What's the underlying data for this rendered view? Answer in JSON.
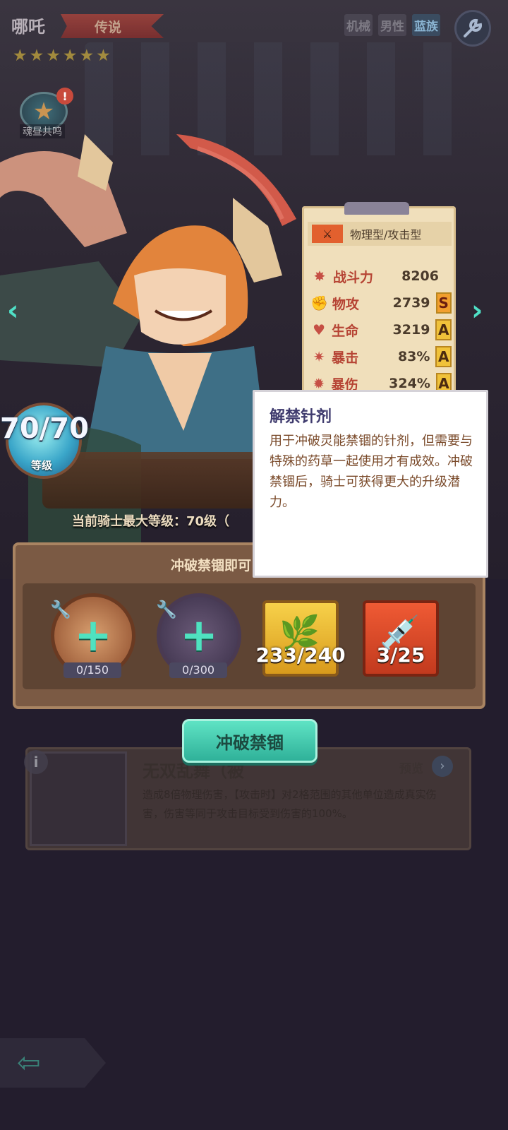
{
  "hero": {
    "name": "哪吒",
    "rarity": "传说",
    "stars": [
      "★",
      "★",
      "★",
      "★",
      "★",
      "★"
    ],
    "tags": [
      "机械",
      "男性",
      "蓝族"
    ],
    "soul_label": "魂昼共鸣"
  },
  "stats": {
    "type": "物理型/攻击型",
    "rows": [
      {
        "label": "战斗力",
        "value": "8206",
        "grade": "",
        "icon": "power-icon"
      },
      {
        "label": "物攻",
        "value": "2739",
        "grade": "S",
        "icon": "fist-icon"
      },
      {
        "label": "生命",
        "value": "3219",
        "grade": "A",
        "icon": "heart-icon"
      },
      {
        "label": "暴击",
        "value": "83%",
        "grade": "A",
        "icon": "crit-icon"
      },
      {
        "label": "暴伤",
        "value": "324%",
        "grade": "A",
        "icon": "crit-damage-icon"
      }
    ]
  },
  "level": {
    "value": "70/70",
    "label": "等级",
    "max_text": "当前骑士最大等级：70级（"
  },
  "breakthrough": {
    "title": "冲破禁锢即可",
    "slots": [
      {
        "count": "0/150",
        "icon": "hero-shard-icon"
      },
      {
        "count": "0/300",
        "icon": "hero-shard-icon"
      },
      {
        "count": "233/240",
        "icon": "herb-icon"
      },
      {
        "count": "3/25",
        "icon": "syringe-icon"
      }
    ],
    "button_label": "冲破禁锢"
  },
  "skill": {
    "name": "无双乱舞（被",
    "preview": "预览",
    "desc": "造成8倍物理伤害，【攻击时】对2格范围的其他单位造成真实伤害，伤害等同于攻击目标受到伤害的100%。"
  },
  "tooltip": {
    "title": "解禁针剂",
    "body": "用于冲破灵能禁锢的针剂，但需要与特殊的药草一起使用才有成效。冲破禁锢后，骑士可获得更大的升级潜力。"
  },
  "colors": {
    "accent": "#4fe2c0",
    "stat_label": "#b64434",
    "tooltip_title": "#3f3b6e",
    "grade_s": "#f29f2e",
    "grade_a": "#f0c23a"
  }
}
